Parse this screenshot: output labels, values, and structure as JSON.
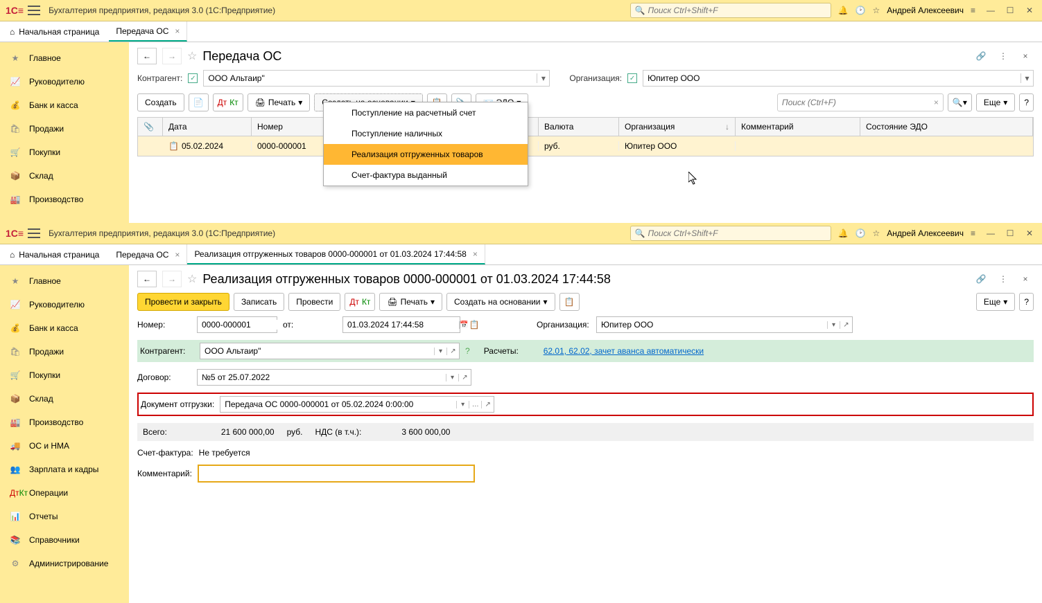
{
  "titlebar": {
    "app_title": "Бухгалтерия предприятия, редакция 3.0  (1С:Предприятие)",
    "search_placeholder": "Поиск Ctrl+Shift+F",
    "username": "Андрей Алексеевич"
  },
  "tabs_top": {
    "home": "Начальная страница",
    "tab1": "Передача ОС"
  },
  "sidebar1": [
    "Главное",
    "Руководителю",
    "Банк и касса",
    "Продажи",
    "Покупки",
    "Склад",
    "Производство"
  ],
  "page1": {
    "title": "Передача ОС",
    "contractor_label": "Контрагент:",
    "contractor_value": "ООО Альтаир\"",
    "org_label": "Организация:",
    "org_value": "Юпитер ООО",
    "btn_create": "Создать",
    "btn_print": "Печать",
    "btn_createon": "Создать на основании",
    "btn_edo": "ЭДО",
    "search_placeholder": "Поиск (Ctrl+F)",
    "btn_more": "Еще",
    "columns": {
      "date": "Дата",
      "number": "Номер",
      "currency": "Валюта",
      "org": "Организация",
      "comment": "Комментарий",
      "edo": "Состояние ЭДО"
    },
    "row": {
      "date": "05.02.2024",
      "number": "0000-000001",
      "currency": "руб.",
      "org": "Юпитер ООО"
    },
    "menu": {
      "m1": "Поступление на расчетный счет",
      "m2": "Поступление наличных",
      "m3": "Реализация отгруженных товаров",
      "m4": "Счет-фактура выданный"
    }
  },
  "tabs_bottom": {
    "home": "Начальная страница",
    "tab1": "Передача ОС",
    "tab2": "Реализация отгруженных товаров 0000-000001 от 01.03.2024 17:44:58"
  },
  "sidebar2": [
    "Главное",
    "Руководителю",
    "Банк и касса",
    "Продажи",
    "Покупки",
    "Склад",
    "Производство",
    "ОС и НМА",
    "Зарплата и кадры",
    "Операции",
    "Отчеты",
    "Справочники",
    "Администрирование"
  ],
  "page2": {
    "title": "Реализация отгруженных товаров 0000-000001 от 01.03.2024 17:44:58",
    "btn_postclose": "Провести и закрыть",
    "btn_write": "Записать",
    "btn_post": "Провести",
    "btn_print": "Печать",
    "btn_createon": "Создать на основании",
    "btn_more": "Еще",
    "number_label": "Номер:",
    "number_value": "0000-000001",
    "from_label": "от:",
    "date_value": "01.03.2024 17:44:58",
    "org_label": "Организация:",
    "org_value": "Юпитер ООО",
    "contractor_label": "Контрагент:",
    "contractor_value": "ООО Альтаир\"",
    "calc_label": "Расчеты:",
    "calc_link": "62.01, 62.02, зачет аванса автоматически",
    "contract_label": "Договор:",
    "contract_value": "№5 от 25.07.2022",
    "shipment_label": "Документ отгрузки:",
    "shipment_value": "Передача ОС 0000-000001 от 05.02.2024 0:00:00",
    "total_label": "Всего:",
    "total_value": "21 600 000,00",
    "total_cur": "руб.",
    "vat_label": "НДС (в т.ч.):",
    "vat_value": "3 600 000,00",
    "invoice_label": "Счет-фактура:",
    "invoice_value": "Не требуется",
    "comment_label": "Комментарий:"
  }
}
